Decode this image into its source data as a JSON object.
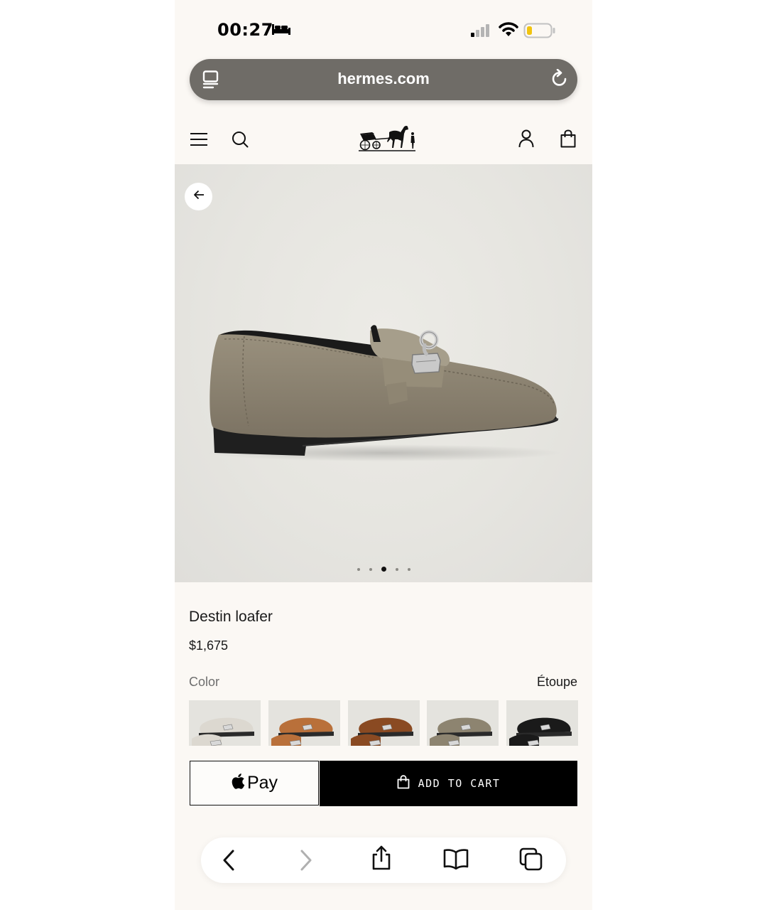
{
  "status_bar": {
    "time": "00:27",
    "focus_icon": "bed-icon",
    "signal_icon": "cellular-signal-icon",
    "wifi_icon": "wifi-icon",
    "battery_icon": "battery-low-icon",
    "battery_level": 0.2
  },
  "browser": {
    "url": "hermes.com",
    "reader_icon": "reader-mode-icon",
    "reload_icon": "reload-icon"
  },
  "site_header": {
    "menu_icon": "hamburger-menu-icon",
    "search_icon": "search-icon",
    "logo": "hermes-carriage-logo",
    "account_icon": "user-icon",
    "bag_icon": "shopping-bag-icon"
  },
  "hero": {
    "back_icon": "arrow-left-icon",
    "image": "taupe suede loafer with silver hardware",
    "carousel": {
      "count": 5,
      "active_index": 2
    }
  },
  "product": {
    "name": "Destin loafer",
    "price": "$1,675",
    "color_label": "Color",
    "color_value": "Étoupe",
    "swatches": [
      {
        "name": "white-loafer",
        "color": "#dcd8d0"
      },
      {
        "name": "tan-loafer",
        "color": "#b9703a"
      },
      {
        "name": "brown-suede-loafer",
        "color": "#8a4a22"
      },
      {
        "name": "etoupe-loafer",
        "color": "#8d8470"
      },
      {
        "name": "black-loafer",
        "color": "#1a1a1a"
      }
    ]
  },
  "actions": {
    "apple_pay_label": "Pay",
    "add_to_cart_label": "ADD TO CART"
  },
  "toolbar": {
    "back_icon": "chevron-left-icon",
    "forward_icon": "chevron-right-icon",
    "share_icon": "share-icon",
    "bookmarks_icon": "book-icon",
    "tabs_icon": "tabs-icon"
  },
  "colors": {
    "page_background": "#fbf8f4",
    "url_bar": "#6f6c67",
    "button_black": "#000000",
    "hero_background": "#e6e5e0"
  }
}
